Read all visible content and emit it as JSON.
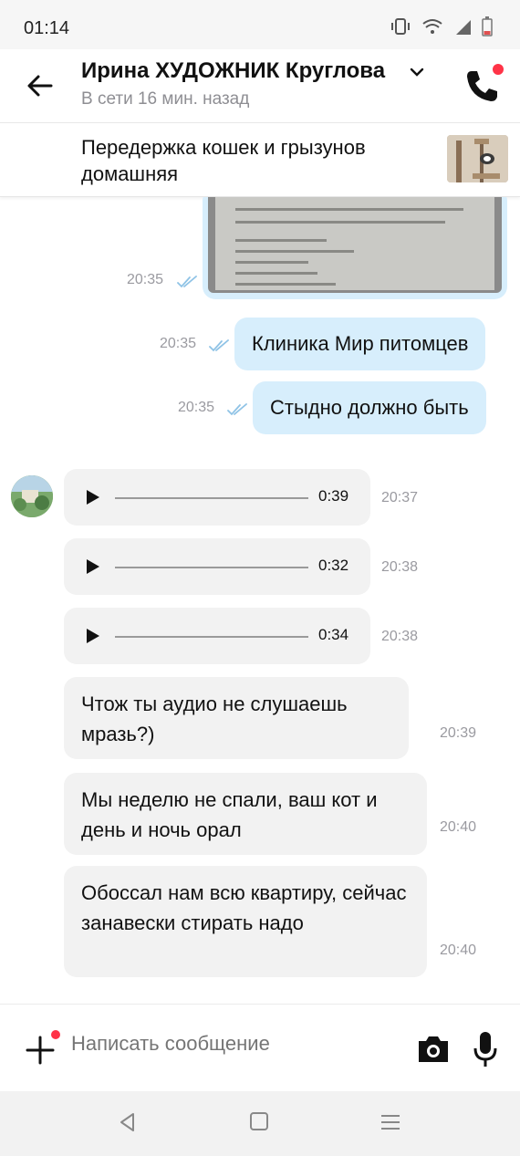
{
  "status_bar": {
    "time": "01:14"
  },
  "header": {
    "contact_name": "Ирина ХУДОЖНИК Круглова",
    "last_seen": "В сети 16 мин. назад"
  },
  "listing": {
    "title": "Передержка кошек и грызунов домашняя"
  },
  "messages": {
    "photo": {
      "time": "20:35"
    },
    "out": [
      {
        "text": "Клиника Мир питомцев",
        "time": "20:35"
      },
      {
        "text": "Стыдно должно быть",
        "time": "20:35"
      }
    ],
    "voice": [
      {
        "duration": "0:39",
        "time": "20:37"
      },
      {
        "duration": "0:32",
        "time": "20:38"
      },
      {
        "duration": "0:34",
        "time": "20:38"
      }
    ],
    "in": [
      {
        "text": "Чтож ты аудио не слушаешь мразь?)",
        "time": "20:39"
      },
      {
        "text": "Мы неделю не спали, ваш кот и день и ночь орал",
        "time": "20:40"
      },
      {
        "text": "Обоссал нам всю квартиру, сейчас занавески стирать надо",
        "time": "20:40"
      }
    ]
  },
  "composer": {
    "placeholder": "Написать сообщение"
  },
  "icons": {
    "back": "arrow-left-icon",
    "chevron": "chevron-down-icon",
    "call": "phone-icon",
    "play": "play-icon",
    "read": "double-check-icon",
    "attach": "plus-icon",
    "camera": "camera-icon",
    "mic": "microphone-icon"
  },
  "colors": {
    "outgoing_bubble": "#d7eefc",
    "incoming_bubble": "#f2f2f2",
    "notification_dot": "#ff3347",
    "read_ticks": "#8fc3e6"
  }
}
